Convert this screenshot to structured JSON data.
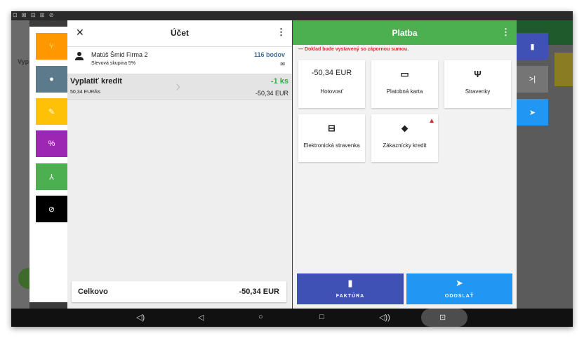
{
  "background": {
    "status_glyphs": "⊡ ⊠ ⊟ ⊞ ⊘",
    "left_text": "Vyp",
    "colors": {
      "left": "#6a6a6a",
      "right": "#5b5b5b"
    }
  },
  "tools": [
    {
      "name": "split",
      "icon": "⑂",
      "color": "#ff9800"
    },
    {
      "name": "customer",
      "icon": "●",
      "color": "#5b7b8c"
    },
    {
      "name": "edit",
      "icon": "✎",
      "color": "#ffc107"
    },
    {
      "name": "discount",
      "icon": "%",
      "color": "#9c27b0"
    },
    {
      "name": "merge",
      "icon": "⅄",
      "color": "#4caf50"
    },
    {
      "name": "no-sync",
      "icon": "⊘",
      "color": "#000000"
    }
  ],
  "account": {
    "close_icon": "✕",
    "title": "Účet",
    "menu_icon": "⋮",
    "customer": {
      "name": "Matúš Šmid Firma 2",
      "group": "Slevová skupina 5%",
      "points": "116 bodov",
      "mail_icon": "✉"
    },
    "item": {
      "name": "Vyplatiť kredit",
      "unit_price": "50,34 EUR/ks",
      "arrow_icon": "›",
      "quantity": "-1 ks",
      "total": "-50,34 EUR"
    },
    "total_label": "Celkovo",
    "total_value": "-50,34 EUR"
  },
  "payment": {
    "title": "Platba",
    "menu_icon": "⋮",
    "warning": "—  Doklad bude vystavený so zápornou sumou.",
    "tiles": [
      {
        "icon": "-50,34 EUR",
        "label": "Hotovosť"
      },
      {
        "icon": "▭",
        "label": "Platobná karta"
      },
      {
        "icon": "Ψ",
        "label": "Stravenky"
      },
      {
        "icon": "⊟",
        "label": "Elektronická stravenka"
      },
      {
        "icon": "⬥",
        "label": "Zákaznícky kredit",
        "warning_icon": "▲"
      }
    ],
    "invoice": {
      "icon": "▮",
      "label": "FAKTÚRA",
      "color": "#3f51b5"
    },
    "send": {
      "icon": "➤",
      "label": "ODOSLAŤ",
      "color": "#2196f3"
    }
  },
  "side_buttons": [
    {
      "icon": "▮",
      "color": "#3f51b5"
    },
    {
      "icon": ">|",
      "color": "#757575"
    },
    {
      "icon": "➤",
      "color": "#2196f3"
    }
  ],
  "navbar": {
    "volume_down": "◁)",
    "back": "◁",
    "home": "○",
    "recents": "□",
    "volume_up": "◁))",
    "screenshot": "⊡"
  }
}
